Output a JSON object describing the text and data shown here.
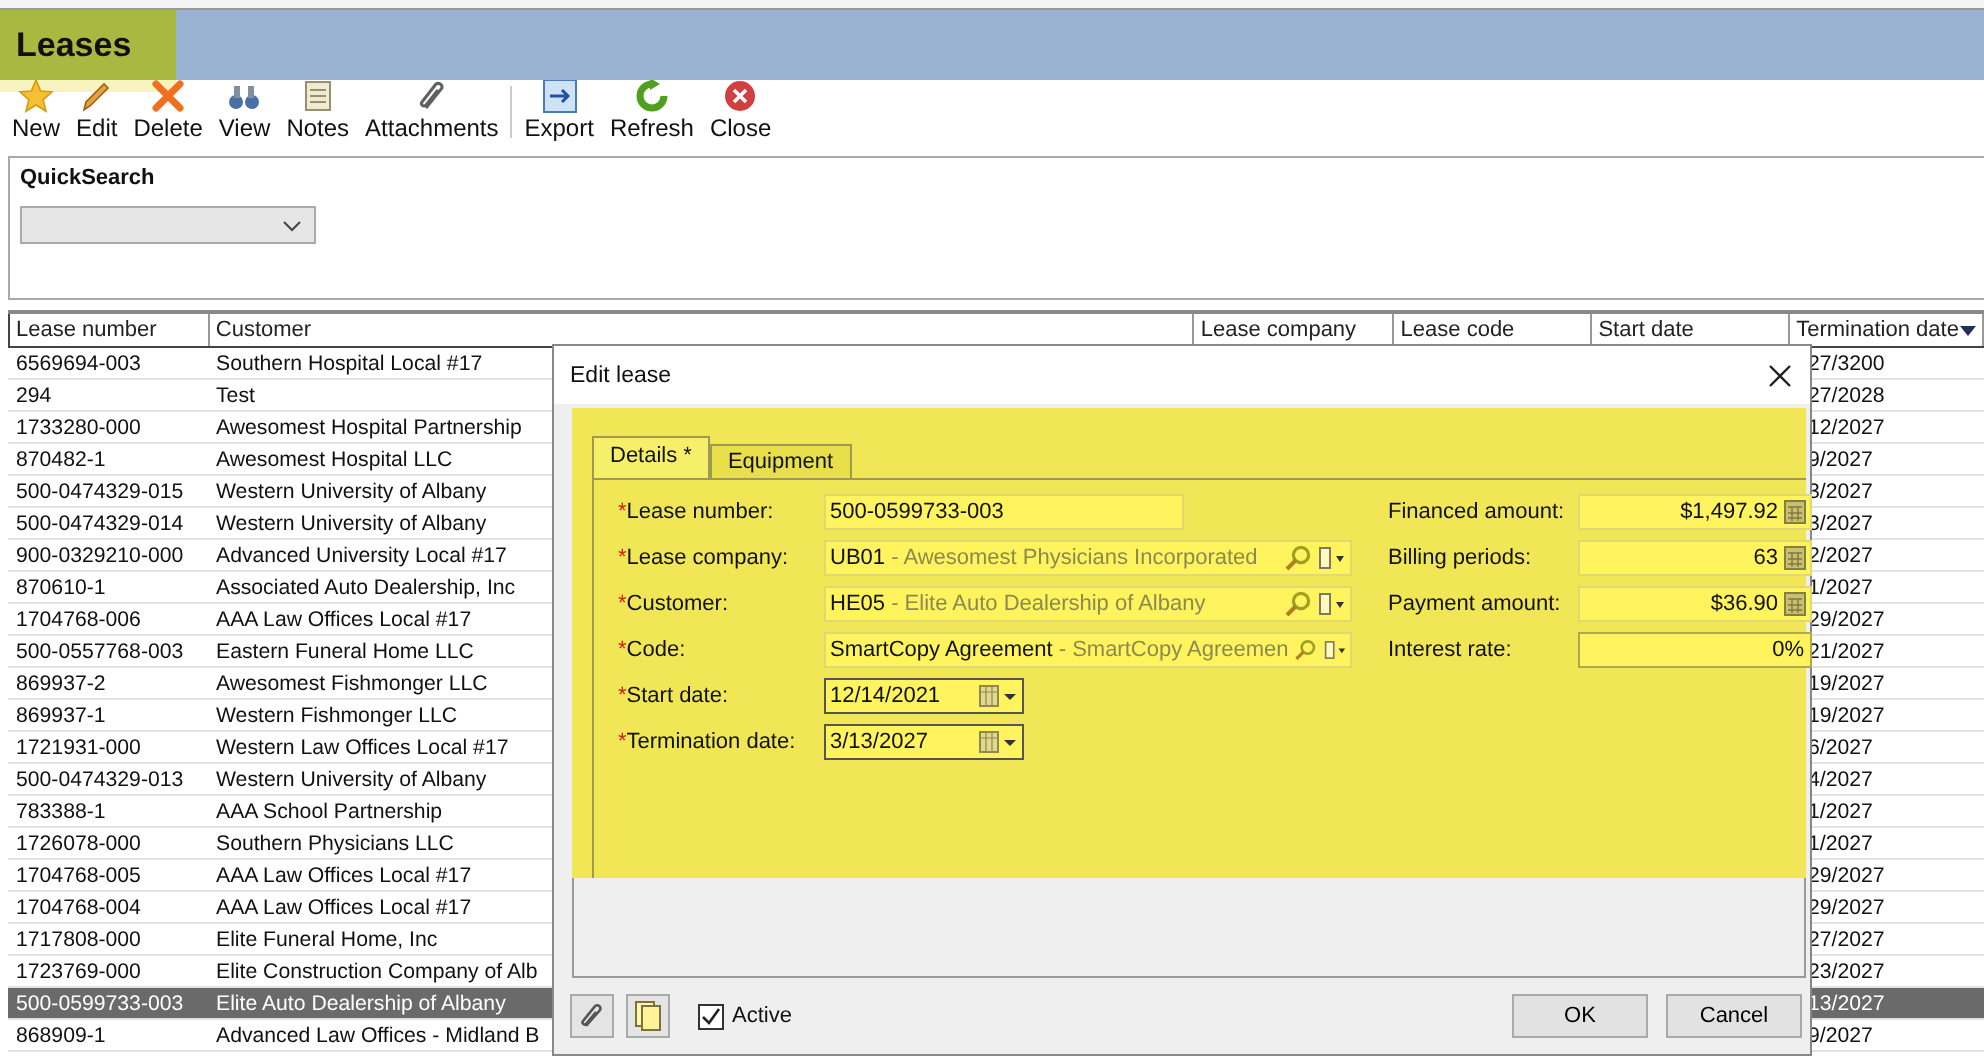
{
  "window": {
    "title": "Leases"
  },
  "toolbar": [
    {
      "label": "New"
    },
    {
      "label": "Edit"
    },
    {
      "label": "Delete"
    },
    {
      "label": "View"
    },
    {
      "label": "Notes"
    },
    {
      "label": "Attachments"
    },
    {
      "label": "Export"
    },
    {
      "label": "Refresh"
    },
    {
      "label": "Close"
    }
  ],
  "quicksearch": {
    "label": "QuickSearch"
  },
  "table": {
    "columns": [
      {
        "label": "Lease number"
      },
      {
        "label": "Customer"
      },
      {
        "label": "Lease company"
      },
      {
        "label": "Lease code"
      },
      {
        "label": "Start date"
      },
      {
        "label": "Termination date",
        "sorted": true
      }
    ],
    "rows": [
      {
        "lease_number": "6569694-003",
        "customer": "Southern Hospital Local #17",
        "termination_date": "27/3200",
        "selected": false
      },
      {
        "lease_number": "294",
        "customer": "Test",
        "termination_date": "27/2028",
        "selected": false
      },
      {
        "lease_number": "1733280-000",
        "customer": "Awesomest Hospital Partnership",
        "termination_date": "12/2027",
        "selected": false
      },
      {
        "lease_number": "870482-1",
        "customer": "Awesomest Hospital LLC",
        "termination_date": "9/2027",
        "selected": false
      },
      {
        "lease_number": "500-0474329-015",
        "customer": "Western University of Albany",
        "termination_date": "3/2027",
        "selected": false
      },
      {
        "lease_number": "500-0474329-014",
        "customer": "Western University of Albany",
        "termination_date": "3/2027",
        "selected": false
      },
      {
        "lease_number": "900-0329210-000",
        "customer": "Advanced University Local #17",
        "termination_date": "2/2027",
        "selected": false
      },
      {
        "lease_number": "870610-1",
        "customer": "Associated Auto Dealership, Inc",
        "termination_date": "1/2027",
        "selected": false
      },
      {
        "lease_number": "1704768-006",
        "customer": "AAA Law Offices Local #17",
        "termination_date": "29/2027",
        "selected": false
      },
      {
        "lease_number": "500-0557768-003",
        "customer": "Eastern Funeral Home LLC",
        "termination_date": "21/2027",
        "selected": false
      },
      {
        "lease_number": "869937-2",
        "customer": "Awesomest Fishmonger LLC",
        "termination_date": "19/2027",
        "selected": false
      },
      {
        "lease_number": "869937-1",
        "customer": "Western Fishmonger LLC",
        "termination_date": "19/2027",
        "selected": false
      },
      {
        "lease_number": "1721931-000",
        "customer": "Western Law Offices Local #17",
        "termination_date": "6/2027",
        "selected": false
      },
      {
        "lease_number": "500-0474329-013",
        "customer": "Western University of Albany",
        "termination_date": "4/2027",
        "selected": false
      },
      {
        "lease_number": "783388-1",
        "customer": "AAA School Partnership",
        "termination_date": "1/2027",
        "selected": false
      },
      {
        "lease_number": "1726078-000",
        "customer": "Southern Physicians LLC",
        "termination_date": "1/2027",
        "selected": false
      },
      {
        "lease_number": "1704768-005",
        "customer": "AAA Law Offices Local #17",
        "termination_date": "29/2027",
        "selected": false
      },
      {
        "lease_number": "1704768-004",
        "customer": "AAA Law Offices Local #17",
        "termination_date": "29/2027",
        "selected": false
      },
      {
        "lease_number": "1717808-000",
        "customer": "Elite Funeral Home, Inc",
        "termination_date": "27/2027",
        "selected": false
      },
      {
        "lease_number": "1723769-000",
        "customer": "Elite Construction Company of Alb",
        "termination_date": "23/2027",
        "selected": false
      },
      {
        "lease_number": "500-0599733-003",
        "customer": "Elite Auto Dealership of Albany",
        "termination_date": "13/2027",
        "selected": true
      },
      {
        "lease_number": "868909-1",
        "customer": "Advanced Law Offices - Midland B",
        "termination_date": "9/2027",
        "selected": false
      }
    ]
  },
  "dialog": {
    "title": "Edit lease",
    "tabs": [
      {
        "label": "Details *",
        "selected": true
      },
      {
        "label": "Equipment",
        "selected": false
      }
    ],
    "left_fields": [
      {
        "kind": "text",
        "mark": "*",
        "label": "Lease number:",
        "value": "500-0599733-003"
      },
      {
        "kind": "lookup",
        "mark": "*",
        "label": "Lease company:",
        "value": "UB01",
        "description": "- Awesomest Physicians Incorporated"
      },
      {
        "kind": "lookup",
        "mark": "*",
        "label": "Customer:",
        "value": "HE05",
        "description": "- Elite Auto Dealership of Albany"
      },
      {
        "kind": "lookup",
        "mark": "*",
        "label": "Code:",
        "value": "SmartCopy Agreement",
        "description": "- SmartCopy Agreemen"
      },
      {
        "kind": "date",
        "mark": "*",
        "label": "Start date:",
        "value": "12/14/2021"
      },
      {
        "kind": "date",
        "mark": "*",
        "label": "Termination date:",
        "value": "3/13/2027"
      }
    ],
    "right_fields": [
      {
        "kind": "calc",
        "label": "Financed amount:",
        "value": "$1,497.92"
      },
      {
        "kind": "calc",
        "label": "Billing periods:",
        "value": "63"
      },
      {
        "kind": "calc",
        "label": "Payment amount:",
        "value": "$36.90"
      },
      {
        "kind": "text",
        "label": "Interest rate:",
        "value": "0%"
      }
    ],
    "active": {
      "label": "Active",
      "checked": true
    },
    "buttons": [
      {
        "label": "OK"
      },
      {
        "label": "Cancel"
      }
    ]
  }
}
